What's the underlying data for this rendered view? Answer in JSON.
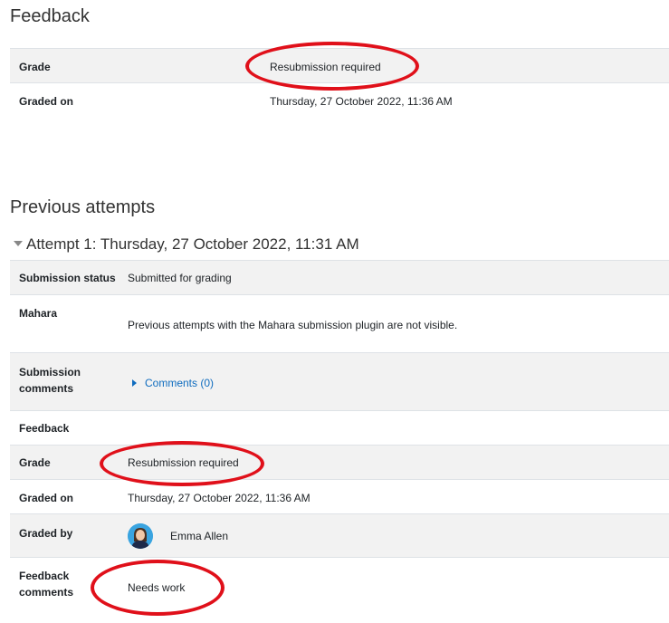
{
  "feedback": {
    "title": "Feedback",
    "rows": [
      {
        "label": "Grade",
        "value": "Resubmission required"
      },
      {
        "label": "Graded on",
        "value": "Thursday, 27 October 2022, 11:36 AM"
      }
    ]
  },
  "previous": {
    "title": "Previous attempts",
    "attempt_header": "Attempt 1: Thursday, 27 October 2022, 11:31 AM",
    "submission_status_label": "Submission status",
    "submission_status_value": "Submitted for grading",
    "mahara_label": "Mahara",
    "mahara_value": "Previous attempts with the Mahara submission plugin are not visible.",
    "submission_comments_label_1": "Submission",
    "submission_comments_label_2": "comments",
    "comments_link": "Comments (0)",
    "feedback_label": "Feedback",
    "grade_label": "Grade",
    "grade_value": "Resubmission required",
    "graded_on_label": "Graded on",
    "graded_on_value": "Thursday, 27 October 2022, 11:36 AM",
    "graded_by_label": "Graded by",
    "graded_by_name": "Emma Allen",
    "feedback_comments_label_1": "Feedback",
    "feedback_comments_label_2": "comments",
    "feedback_comments_value": "Needs work"
  },
  "colors": {
    "highlight_ring": "#e0101a",
    "link": "#0f6cbf",
    "row_alt": "#f2f2f2"
  }
}
